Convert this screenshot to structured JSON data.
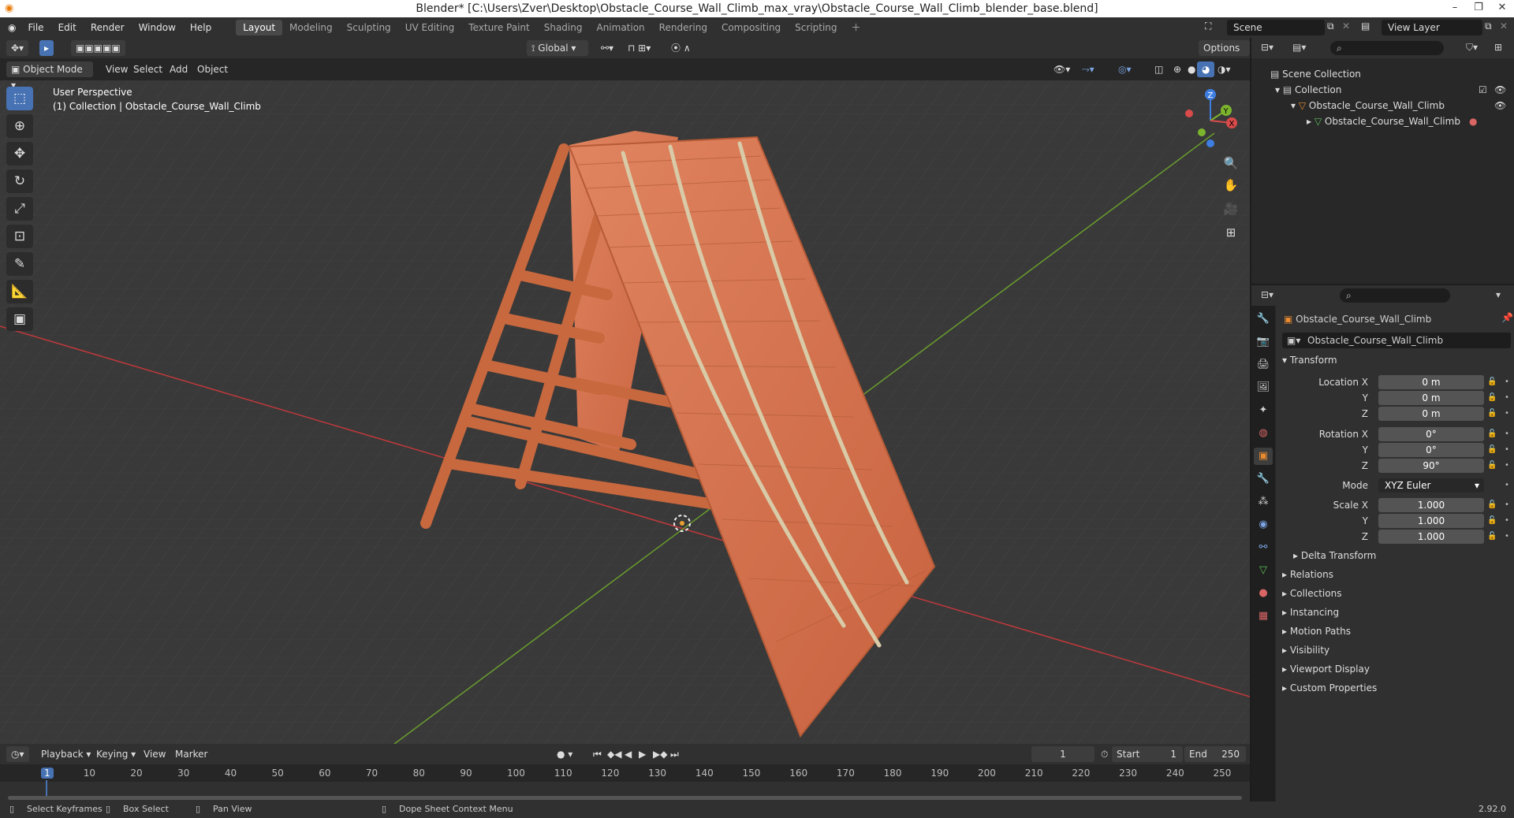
{
  "window": {
    "title": "Blender* [C:\\Users\\Zver\\Desktop\\Obstacle_Course_Wall_Climb_max_vray\\Obstacle_Course_Wall_Climb_blender_base.blend]"
  },
  "menus": [
    "File",
    "Edit",
    "Render",
    "Window",
    "Help"
  ],
  "workspaces": [
    "Layout",
    "Modeling",
    "Sculpting",
    "UV Editing",
    "Texture Paint",
    "Shading",
    "Animation",
    "Rendering",
    "Compositing",
    "Scripting"
  ],
  "active_workspace": "Layout",
  "scene": {
    "name": "Scene",
    "view_layer": "View Layer"
  },
  "viewport": {
    "transform_orientation": "Global",
    "options_label": "Options",
    "mode": "Object Mode",
    "header_menus": [
      "View",
      "Select",
      "Add",
      "Object"
    ],
    "perspective_label": "User Perspective",
    "collection_label": "(1) Collection | Obstacle_Course_Wall_Climb"
  },
  "outliner": {
    "rows": [
      {
        "label": "Scene Collection"
      },
      {
        "label": "Collection"
      },
      {
        "label": "Obstacle_Course_Wall_Climb"
      },
      {
        "label": "Obstacle_Course_Wall_Climb"
      }
    ]
  },
  "properties": {
    "object_name": "Obstacle_Course_Wall_Climb",
    "object_field": "Obstacle_Course_Wall_Climb",
    "transform_label": "Transform",
    "location": {
      "label": "Location X",
      "x": "0 m",
      "y": "0 m",
      "z": "0 m"
    },
    "rotation": {
      "label": "Rotation X",
      "x": "0°",
      "y": "0°",
      "z": "90°"
    },
    "mode": {
      "label": "Mode",
      "value": "XYZ Euler"
    },
    "scale": {
      "label": "Scale X",
      "x": "1.000",
      "y": "1.000",
      "z": "1.000"
    },
    "axis_y": "Y",
    "axis_z": "Z",
    "delta": "Delta Transform",
    "panels": [
      "Relations",
      "Collections",
      "Instancing",
      "Motion Paths",
      "Visibility",
      "Viewport Display",
      "Custom Properties"
    ]
  },
  "timeline": {
    "menus": [
      "Playback",
      "Keying",
      "View",
      "Marker"
    ],
    "current_frame": "1",
    "start_label": "Start",
    "start": "1",
    "end_label": "End",
    "end": "250",
    "ticks": [
      "1",
      "10",
      "20",
      "30",
      "40",
      "50",
      "60",
      "70",
      "80",
      "90",
      "100",
      "110",
      "120",
      "130",
      "140",
      "150",
      "160",
      "170",
      "180",
      "190",
      "200",
      "210",
      "220",
      "230",
      "240",
      "250"
    ]
  },
  "status": {
    "select": "Select Keyframes",
    "box": "Box Select",
    "pan": "Pan View",
    "context": "Dope Sheet Context Menu",
    "version": "2.92.0"
  },
  "colors": {
    "accent": "#4772b3",
    "wood": "#d8724a",
    "x_axis": "#c0393b",
    "y_axis": "#6a9d2d"
  }
}
